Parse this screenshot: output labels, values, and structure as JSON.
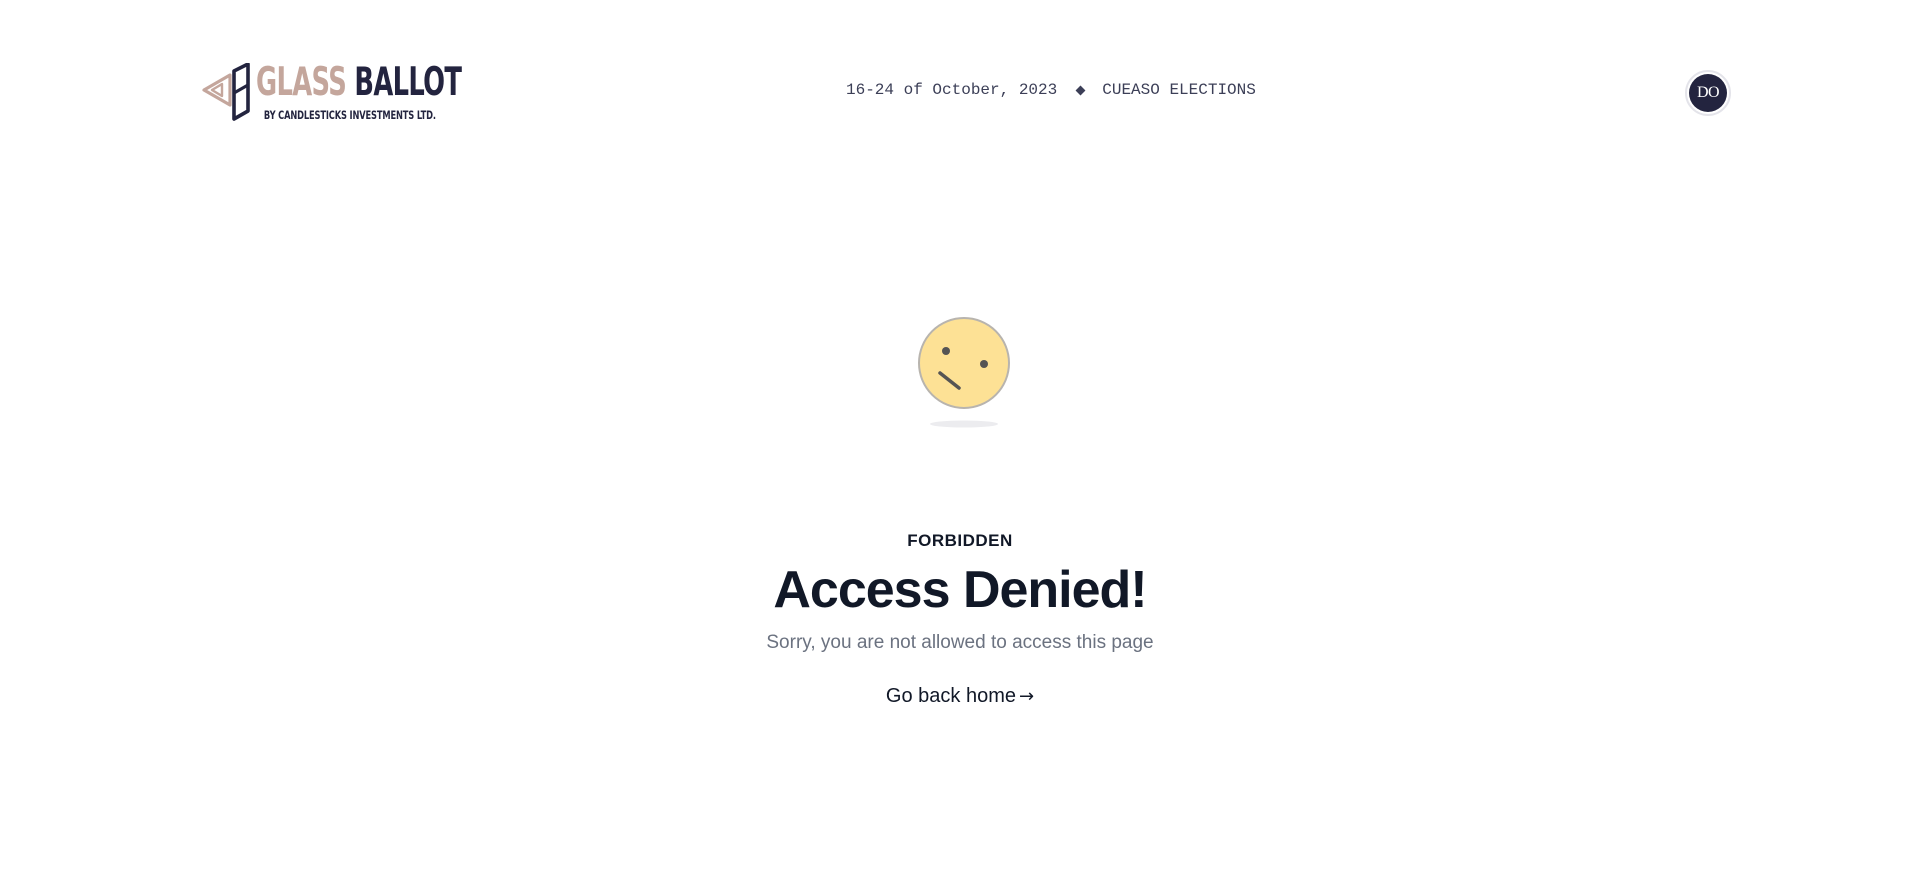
{
  "header": {
    "logo": {
      "title_part1": "GLASS",
      "title_part2": "BALLOT",
      "subtitle": "BY CANDLESTICKS INVESTMENTS LTD.",
      "icon": "glass-ballot-logo-icon"
    },
    "event_dates": "16-24 of October, 2023",
    "event_name": "CUEASO ELECTIONS",
    "separator_icon": "diamond-icon",
    "avatar_initials": "DO"
  },
  "main": {
    "illustration_icon": "confused-face-icon",
    "eyebrow": "FORBIDDEN",
    "title": "Access Denied!",
    "message": "Sorry, you are not allowed to access this page",
    "home_link_label": "Go back home",
    "home_link_arrow": "→"
  },
  "colors": {
    "brand_primary": "#23243f",
    "brand_accent": "#c4a69c",
    "face_fill": "#fde195",
    "heading_text": "#111827",
    "muted_text": "#6b7280",
    "background": "#ffffff"
  }
}
